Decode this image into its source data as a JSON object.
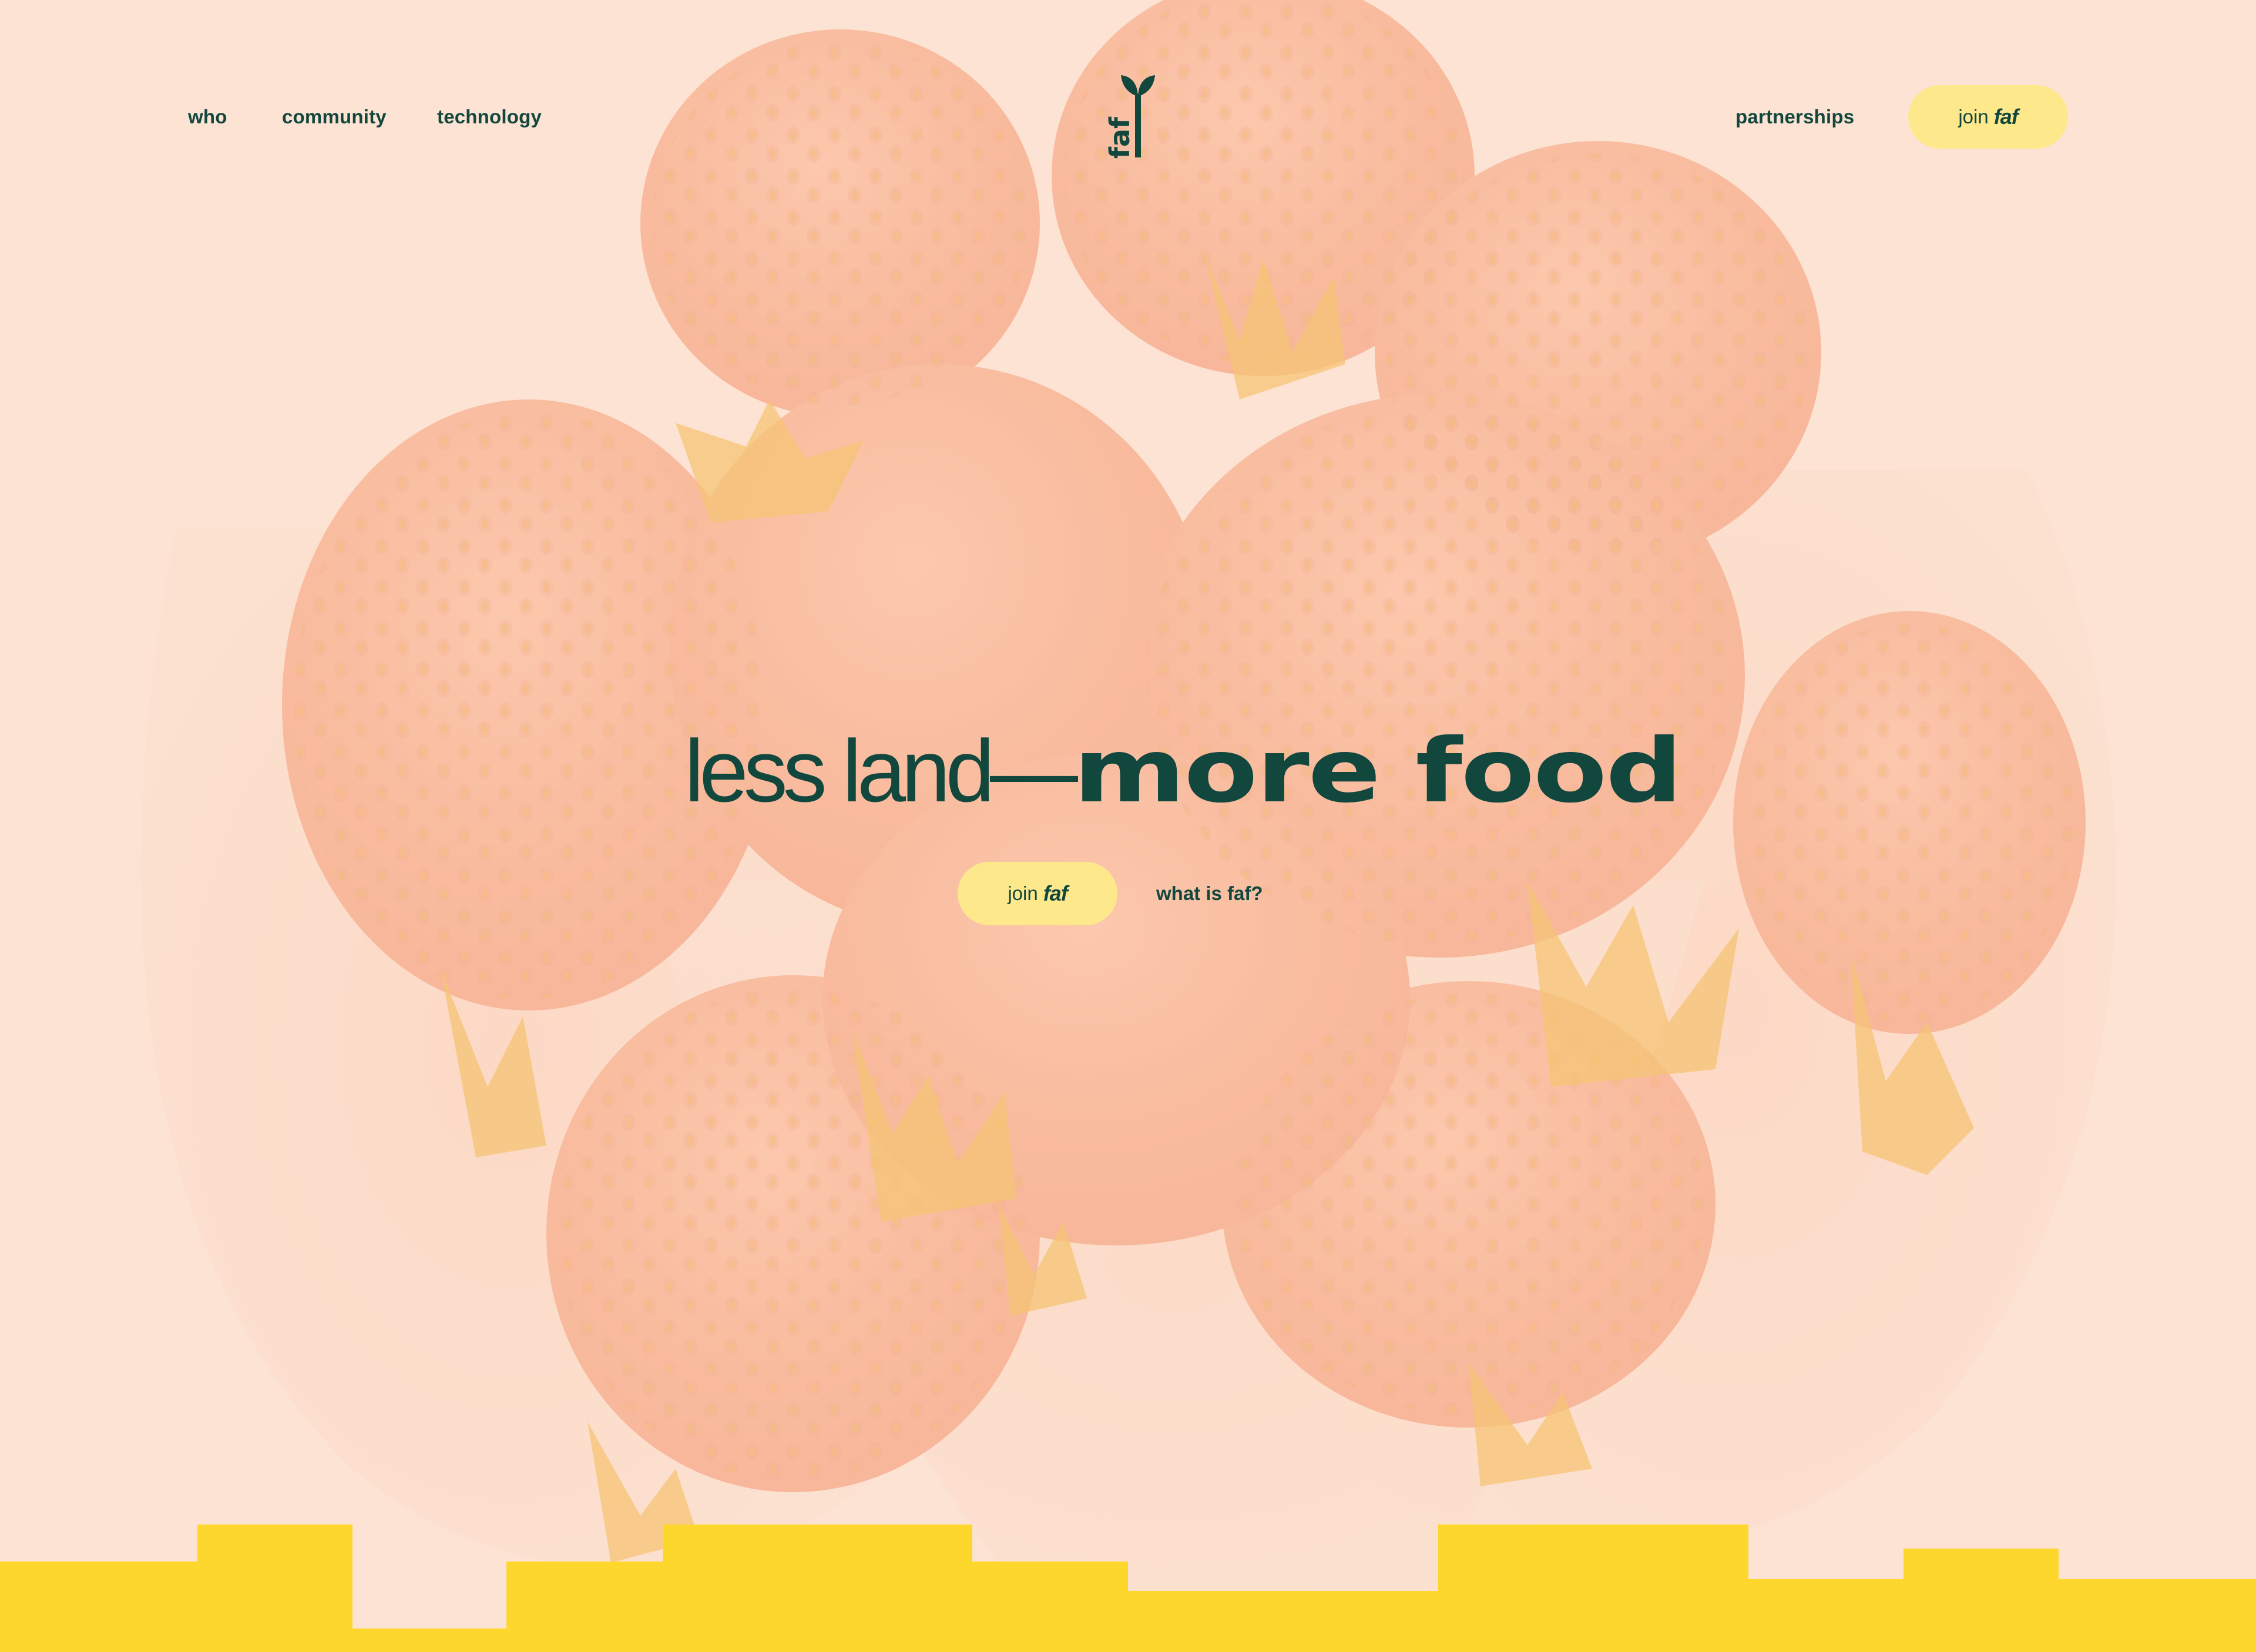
{
  "nav": {
    "left": [
      {
        "label": "who"
      },
      {
        "label": "community"
      },
      {
        "label": "technology"
      }
    ],
    "right_link": "partnerships",
    "cta": {
      "prefix": "join",
      "brand": "faf"
    }
  },
  "logo": {
    "text": "faf",
    "icon": "sprout-icon"
  },
  "hero": {
    "headline_light": "less land—",
    "headline_bold": "more food",
    "cta": {
      "prefix": "join",
      "brand": "faf"
    },
    "secondary_link": "what is faf?",
    "background_image": "strawberries-in-hands"
  },
  "colors": {
    "primary_text": "#12473e",
    "pill_bg": "#fde88c",
    "page_bg": "#fde3d3",
    "footer_yellow": "#fed72c"
  }
}
